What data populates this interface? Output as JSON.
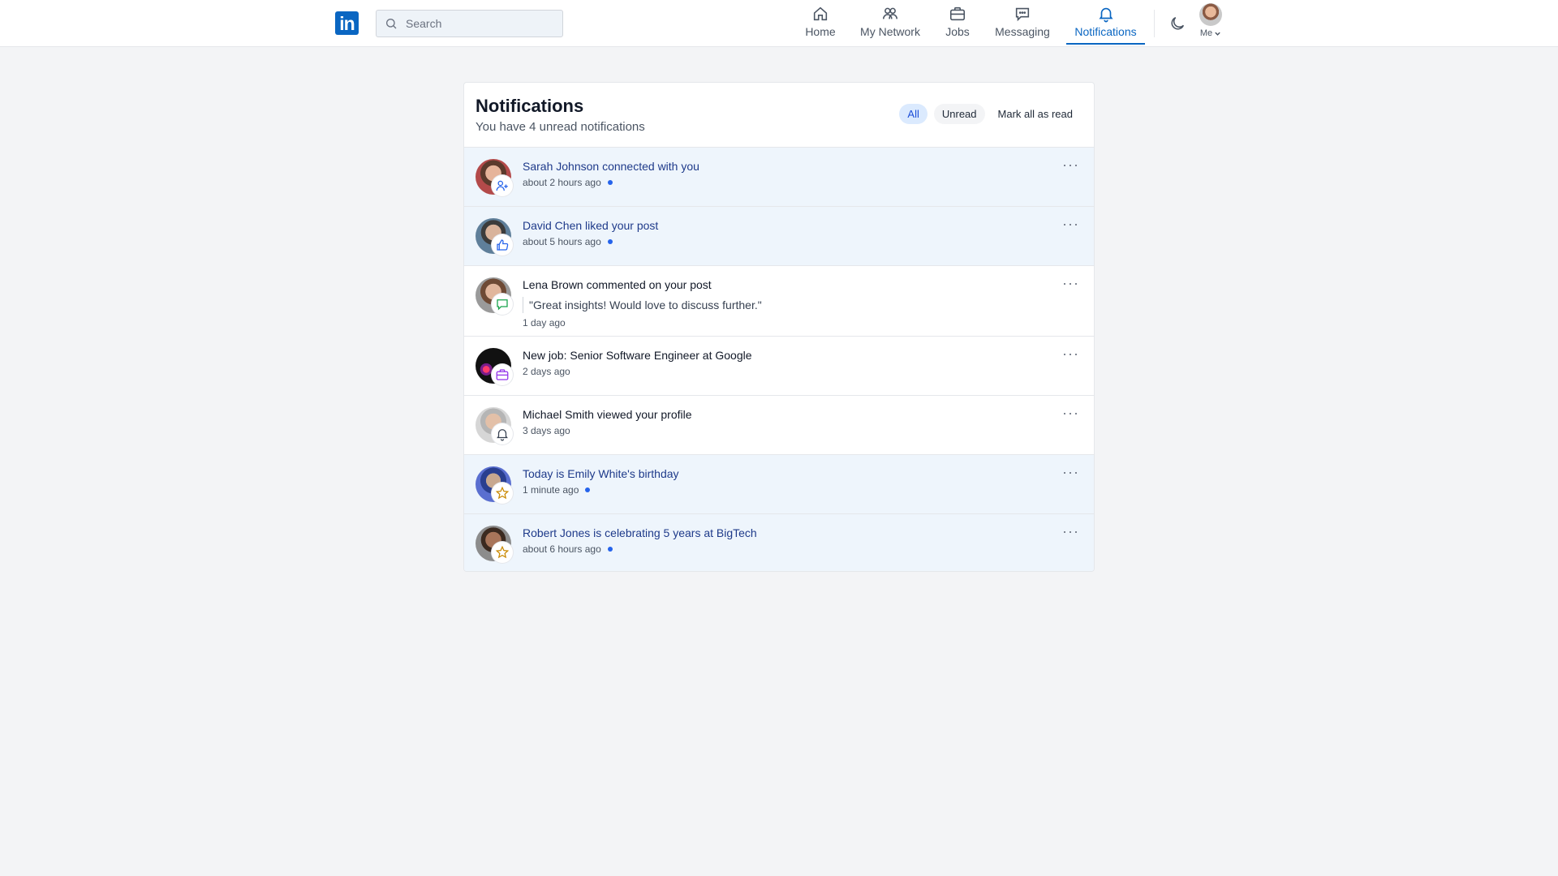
{
  "nav": {
    "logo_text": "in",
    "search_placeholder": "Search",
    "items": [
      {
        "label": "Home",
        "icon": "home-icon"
      },
      {
        "label": "My Network",
        "icon": "network-icon"
      },
      {
        "label": "Jobs",
        "icon": "briefcase-icon"
      },
      {
        "label": "Messaging",
        "icon": "message-icon"
      },
      {
        "label": "Notifications",
        "icon": "bell-icon",
        "active": true
      }
    ],
    "me_label": "Me"
  },
  "page": {
    "title": "Notifications",
    "subtitle": "You have 4 unread notifications",
    "filters": {
      "all": "All",
      "unread": "Unread",
      "mark_all": "Mark all as read"
    }
  },
  "notifications": [
    {
      "text": "Sarah Johnson connected with you",
      "time": "about 2 hours ago",
      "unread": true,
      "badge_icon": "user-plus-icon"
    },
    {
      "text": "David Chen liked your post",
      "time": "about 5 hours ago",
      "unread": true,
      "badge_icon": "thumbs-up-icon"
    },
    {
      "text": "Lena Brown commented on your post",
      "quote": "\"Great insights! Would love to discuss further.\"",
      "time": "1 day ago",
      "unread": false,
      "badge_icon": "comment-icon"
    },
    {
      "text": "New job: Senior Software Engineer at Google",
      "time": "2 days ago",
      "unread": false,
      "badge_icon": "briefcase-icon"
    },
    {
      "text": "Michael Smith viewed your profile",
      "time": "3 days ago",
      "unread": false,
      "badge_icon": "bell-icon"
    },
    {
      "text": "Today is Emily White's birthday",
      "time": "1 minute ago",
      "unread": true,
      "badge_icon": "star-icon"
    },
    {
      "text": "Robert Jones is celebrating 5 years at BigTech",
      "time": "about 6 hours ago",
      "unread": true,
      "badge_icon": "star-icon"
    }
  ],
  "colors": {
    "brand": "#0a66c2",
    "unread_bg": "#eef5fc",
    "unread_dot": "#2563eb"
  }
}
